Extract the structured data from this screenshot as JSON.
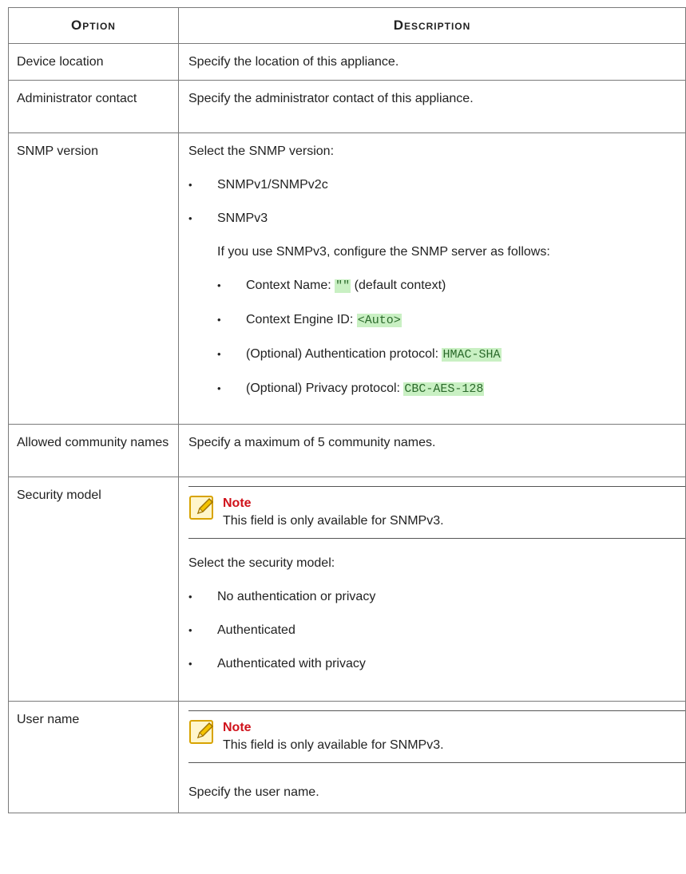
{
  "headers": {
    "option": "Option",
    "description": "Description"
  },
  "rows": {
    "device_location": {
      "option": "Device location",
      "desc": "Specify the location of this appliance."
    },
    "admin_contact": {
      "option": "Administrator contact",
      "desc": "Specify the administrator contact of this appliance."
    },
    "snmp_version": {
      "option": "SNMP version",
      "intro": "Select the SNMP version:",
      "items": [
        "SNMPv1/SNMPv2c",
        "SNMPv3"
      ],
      "v3_intro": "If you use SNMPv3, configure the SNMP server as follows:",
      "sub": {
        "context_name_label": "Context Name: ",
        "context_name_code": "\"\"",
        "context_name_suffix": " (default context)",
        "engine_id_label": "Context Engine ID: ",
        "engine_id_code": "<Auto>",
        "auth_label": "(Optional) Authentication protocol: ",
        "auth_code": "HMAC-SHA",
        "privacy_label": "(Optional) Privacy protocol: ",
        "privacy_code": "CBC-AES-128"
      }
    },
    "community_names": {
      "option": "Allowed community names",
      "desc": "Specify a maximum of 5 community names."
    },
    "security_model": {
      "option": "Security model",
      "note_title": "Note",
      "note_text": "This field is only available for SNMPv3.",
      "intro": "Select the security model:",
      "items": [
        "No authentication or privacy",
        "Authenticated",
        "Authenticated with privacy"
      ]
    },
    "user_name": {
      "option": "User name",
      "note_title": "Note",
      "note_text": "This field is only available for SNMPv3.",
      "desc": "Specify the user name."
    }
  }
}
